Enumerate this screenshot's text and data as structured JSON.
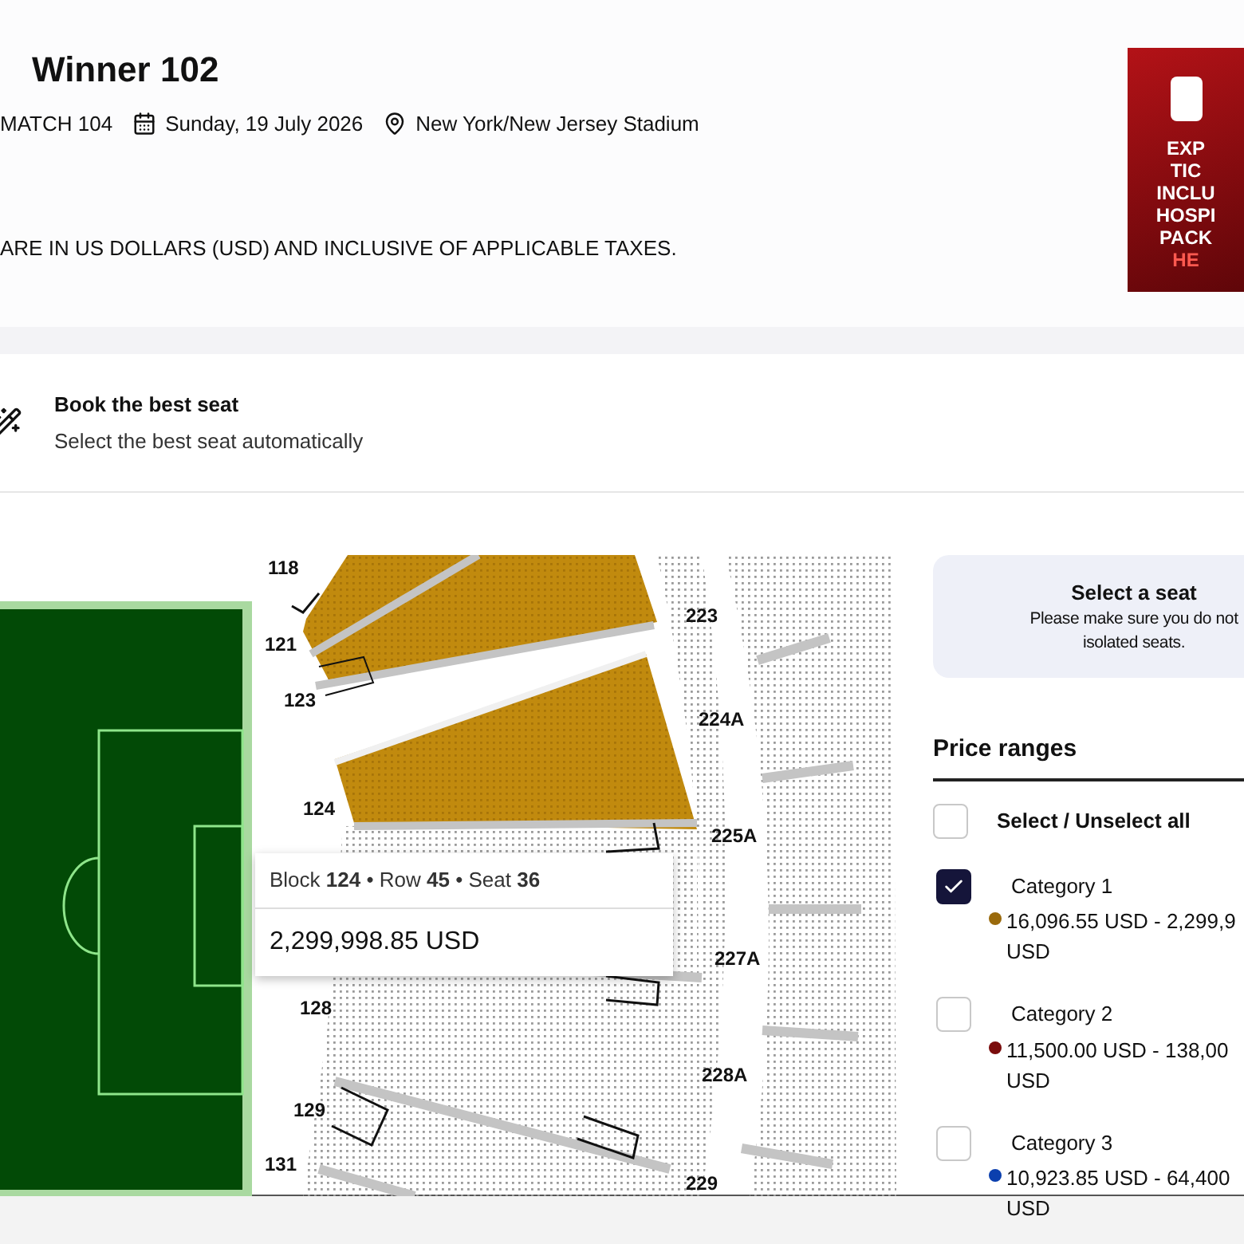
{
  "header": {
    "title": "Winner 102",
    "match": "MATCH 104",
    "date": "Sunday, 19 July 2026",
    "venue": "New York/New Jersey Stadium",
    "notice": "ARE IN US DOLLARS (USD) AND INCLUSIVE OF APPLICABLE TAXES."
  },
  "ad": {
    "lines": [
      "EXP",
      "TIC",
      "INCLU",
      "HOSPI",
      "PACK",
      "HE"
    ]
  },
  "best_seat": {
    "title": "Book the best seat",
    "subtitle": "Select the best seat automatically"
  },
  "map": {
    "section_labels": [
      "118",
      "121",
      "123",
      "124",
      "128",
      "129",
      "131",
      "223",
      "224A",
      "225A",
      "227A",
      "228A",
      "229"
    ]
  },
  "tooltip": {
    "details": "Block **124** • Row **45** • Seat **36**",
    "price": "2,299,998.85 USD"
  },
  "seat_info": {
    "title": "Select a seat",
    "lines": [
      "Please make sure you do not",
      "isolated seats."
    ]
  },
  "price_ranges": {
    "title": "Price ranges",
    "select_all": {
      "label": "Select / Unselect all",
      "checked": false
    },
    "categories": [
      {
        "name": "Category 1",
        "checked": true,
        "color": "#9a6a0c",
        "price_lines": [
          "16,096.55 USD - 2,299,9",
          "USD"
        ]
      },
      {
        "name": "Category 2",
        "checked": false,
        "color": "#7a0c0c",
        "price_lines": [
          "11,500.00 USD - 138,00",
          "USD"
        ]
      },
      {
        "name": "Category 3",
        "checked": false,
        "color": "#0b3fae",
        "price_lines": [
          "10,923.85 USD - 64,400",
          "USD"
        ]
      }
    ]
  }
}
